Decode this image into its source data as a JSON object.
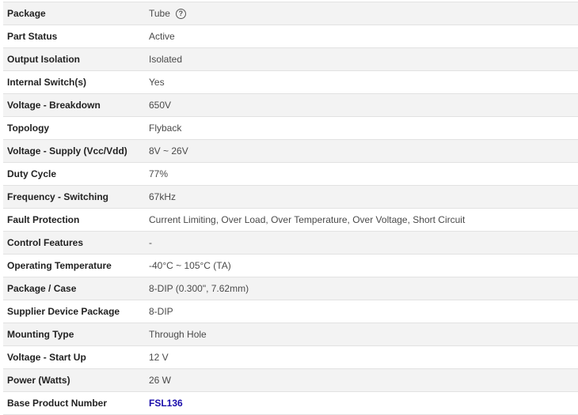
{
  "specs": [
    {
      "label": "Package",
      "value": "Tube",
      "help_icon": "question-circle-icon"
    },
    {
      "label": "Part Status",
      "value": "Active"
    },
    {
      "label": "Output Isolation",
      "value": "Isolated"
    },
    {
      "label": "Internal Switch(s)",
      "value": "Yes"
    },
    {
      "label": "Voltage - Breakdown",
      "value": "650V"
    },
    {
      "label": "Topology",
      "value": "Flyback"
    },
    {
      "label": "Voltage - Supply (Vcc/Vdd)",
      "value": "8V ~ 26V"
    },
    {
      "label": "Duty Cycle",
      "value": "77%"
    },
    {
      "label": "Frequency - Switching",
      "value": "67kHz"
    },
    {
      "label": "Fault Protection",
      "value": "Current Limiting, Over Load, Over Temperature, Over Voltage, Short Circuit"
    },
    {
      "label": "Control Features",
      "value": "-"
    },
    {
      "label": "Operating Temperature",
      "value": "-40°C ~ 105°C (TA)"
    },
    {
      "label": "Package / Case",
      "value": "8-DIP (0.300\", 7.62mm)"
    },
    {
      "label": "Supplier Device Package",
      "value": "8-DIP"
    },
    {
      "label": "Mounting Type",
      "value": "Through Hole"
    },
    {
      "label": "Voltage - Start Up",
      "value": "12 V"
    },
    {
      "label": "Power (Watts)",
      "value": "26 W"
    },
    {
      "label": "Base Product Number",
      "value": "FSL136",
      "is_link": true
    }
  ],
  "colors": {
    "row_alt": "#f3f3f3",
    "border": "#e2e2e2",
    "link": "#1a0dab"
  }
}
